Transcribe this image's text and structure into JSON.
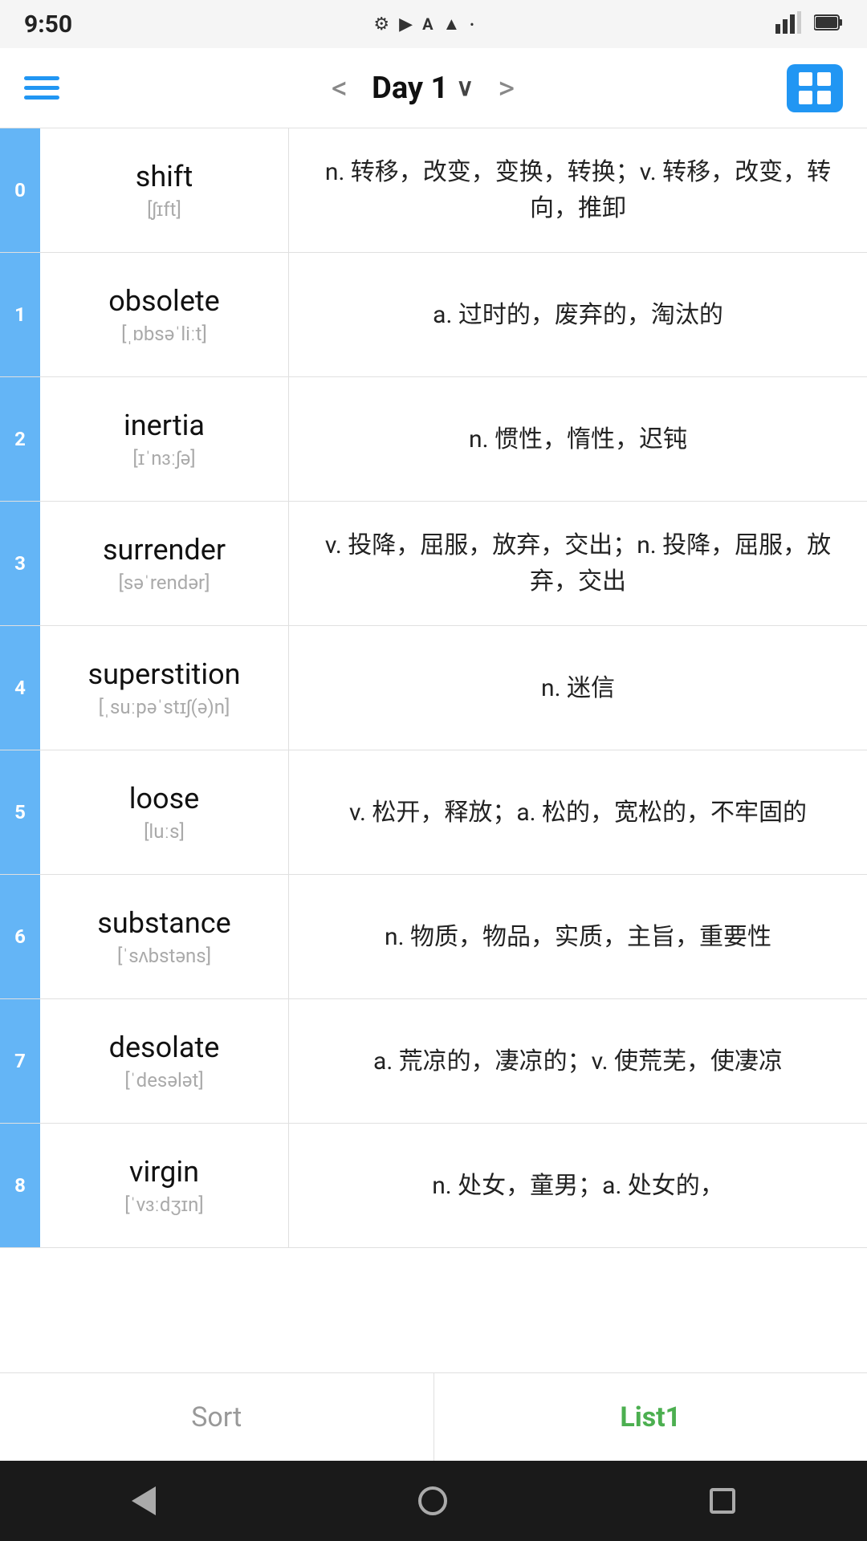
{
  "statusBar": {
    "time": "9:50",
    "icons": [
      "gear-icon",
      "play-icon",
      "font-icon",
      "wifi-icon",
      "dot-icon"
    ]
  },
  "navBar": {
    "prevLabel": "<",
    "nextLabel": ">",
    "title": "Day 1",
    "chevron": "∨"
  },
  "vocabItems": [
    {
      "index": "0",
      "word": "shift",
      "phonetic": "[ʃɪft]",
      "definition": "n. 转移，改变，变换，转换；v. 转移，改变，转向，推卸"
    },
    {
      "index": "1",
      "word": "obsolete",
      "phonetic": "[ˌɒbsəˈliːt]",
      "definition": "a. 过时的，废弃的，淘汰的"
    },
    {
      "index": "2",
      "word": "inertia",
      "phonetic": "[ɪˈnɜːʃə]",
      "definition": "n. 惯性，惰性，迟钝"
    },
    {
      "index": "3",
      "word": "surrender",
      "phonetic": "[səˈrendər]",
      "definition": "v. 投降，屈服，放弃，交出；n. 投降，屈服，放弃，交出"
    },
    {
      "index": "4",
      "word": "superstition",
      "phonetic": "[ˌsuːpəˈstɪʃ(ə)n]",
      "definition": "n. 迷信"
    },
    {
      "index": "5",
      "word": "loose",
      "phonetic": "[luːs]",
      "definition": "v. 松开，释放；a. 松的，宽松的，不牢固的"
    },
    {
      "index": "6",
      "word": "substance",
      "phonetic": "[ˈsʌbstəns]",
      "definition": "n. 物质，物品，实质，主旨，重要性"
    },
    {
      "index": "7",
      "word": "desolate",
      "phonetic": "[ˈdesələt]",
      "definition": "a. 荒凉的，凄凉的；v. 使荒芜，使凄凉"
    },
    {
      "index": "8",
      "word": "virgin",
      "phonetic": "[ˈvɜːdʒɪn]",
      "definition": "n. 处女，童男；a. 处女的，"
    }
  ],
  "bottomTabs": [
    {
      "label": "Sort",
      "active": false
    },
    {
      "label": "List1",
      "active": true
    }
  ],
  "androidNav": {
    "back": "◀",
    "home": "●",
    "recent": "■"
  }
}
